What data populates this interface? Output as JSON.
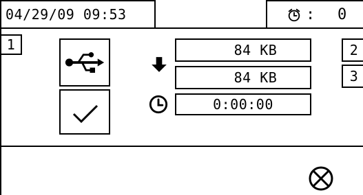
{
  "header": {
    "datetime": "04/29/09 09:53",
    "counter_value": "0",
    "counter_icon": "alarm-clock-icon"
  },
  "nav": {
    "left_1": "1",
    "right_2": "2",
    "right_3": "3"
  },
  "usb": {
    "usb_icon": "usb-icon",
    "check_icon": "check-icon"
  },
  "transfer": {
    "download_icon": "download-arrow-icon",
    "size_total": "84 KB",
    "size_done": "84 KB",
    "clock_icon": "clock-icon",
    "elapsed": "0:00:00"
  },
  "footer": {
    "cancel_icon": "cancel-circle-x-icon"
  }
}
